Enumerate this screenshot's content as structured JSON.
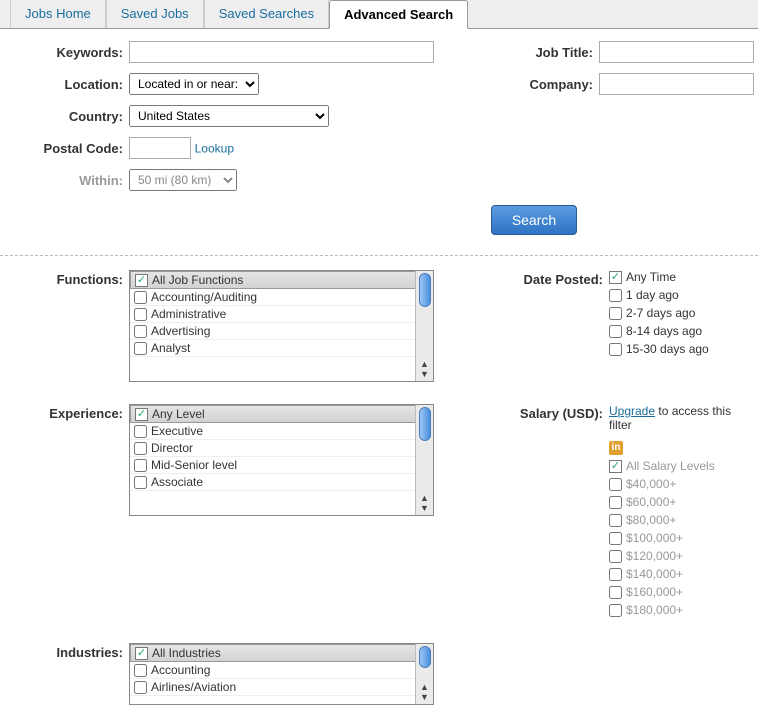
{
  "tabs": {
    "home": "Jobs Home",
    "saved_jobs": "Saved Jobs",
    "saved_searches": "Saved Searches",
    "advanced": "Advanced Search"
  },
  "labels": {
    "keywords": "Keywords:",
    "location": "Location:",
    "country": "Country:",
    "postal": "Postal Code:",
    "within": "Within:",
    "job_title": "Job Title:",
    "company": "Company:",
    "lookup": "Lookup",
    "search": "Search",
    "functions": "Functions:",
    "date_posted": "Date Posted:",
    "experience": "Experience:",
    "salary": "Salary (USD):",
    "industries": "Industries:",
    "upgrade": "Upgrade",
    "upgrade_rest": " to access this filter"
  },
  "values": {
    "location_select": "Located in or near:",
    "country_select": "United States",
    "within_select": "50 mi (80 km)"
  },
  "functions": [
    "All Job Functions",
    "Accounting/Auditing",
    "Administrative",
    "Advertising",
    "Analyst"
  ],
  "date_posted": [
    "Any Time",
    "1 day ago",
    "2-7 days ago",
    "8-14 days ago",
    "15-30 days ago"
  ],
  "experience": [
    "Any Level",
    "Executive",
    "Director",
    "Mid-Senior level",
    "Associate"
  ],
  "industries": [
    "All Industries",
    "Accounting",
    "Airlines/Aviation"
  ],
  "salary_levels": [
    "All Salary Levels",
    "$40,000+",
    "$60,000+",
    "$80,000+",
    "$100,000+",
    "$120,000+",
    "$140,000+",
    "$160,000+",
    "$180,000+"
  ]
}
